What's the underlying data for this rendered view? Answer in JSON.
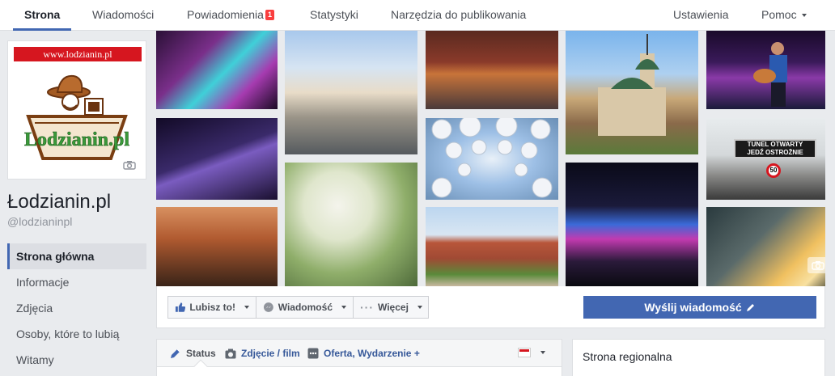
{
  "topnav": {
    "tabs": [
      {
        "label": "Strona"
      },
      {
        "label": "Wiadomości"
      },
      {
        "label": "Powiadomienia",
        "badge": "1"
      },
      {
        "label": "Statystyki"
      },
      {
        "label": "Narzędzia do publikowania"
      }
    ],
    "settings": "Ustawienia",
    "help": "Pomoc"
  },
  "profile": {
    "logo_url_text": "www.lodzianin.pl",
    "logo_wordmark": "Lodzianin.pl",
    "name": "Łodzianin.pl",
    "handle": "@lodzianinpl"
  },
  "leftnav": {
    "items": [
      {
        "label": "Strona główna"
      },
      {
        "label": "Informacje"
      },
      {
        "label": "Zdjęcia"
      },
      {
        "label": "Osoby, które to lubią"
      },
      {
        "label": "Witamy"
      }
    ]
  },
  "actions": {
    "like": "Lubisz to!",
    "message": "Wiadomość",
    "more": "Więcej",
    "send_message": "Wyślij wiadomość"
  },
  "composer": {
    "status": "Status",
    "photo": "Zdjęcie / film",
    "offer": "Oferta, Wydarzenie +"
  },
  "side": {
    "regional": "Strona regionalna"
  },
  "cover": {
    "sign_line1": "TUNEL OTWARTY",
    "sign_line2": "JEDŹ OSTROŻNIE",
    "sign_speed": "50"
  },
  "colors": {
    "accent": "#4267b2",
    "badge": "#fa3e3e",
    "logo_red": "#d6161f",
    "logo_green": "#3a9a3a"
  }
}
